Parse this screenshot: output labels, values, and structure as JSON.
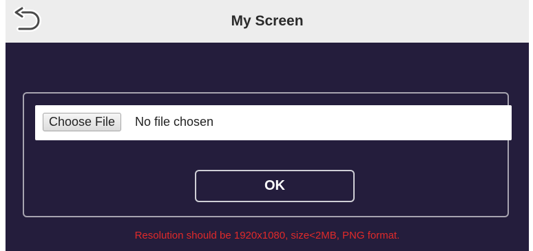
{
  "header": {
    "title": "My Screen",
    "back_icon": "back-arrow-icon"
  },
  "upload": {
    "choose_button_label": "Choose File",
    "file_status": "No file chosen",
    "ok_button_label": "OK"
  },
  "hint": {
    "text": "Resolution should be 1920x1080, size<2MB, PNG format.",
    "color": "#e02a2a"
  },
  "colors": {
    "header_bg": "#ededed",
    "body_bg": "#241d3c",
    "panel_border": "#a7a4b0"
  }
}
